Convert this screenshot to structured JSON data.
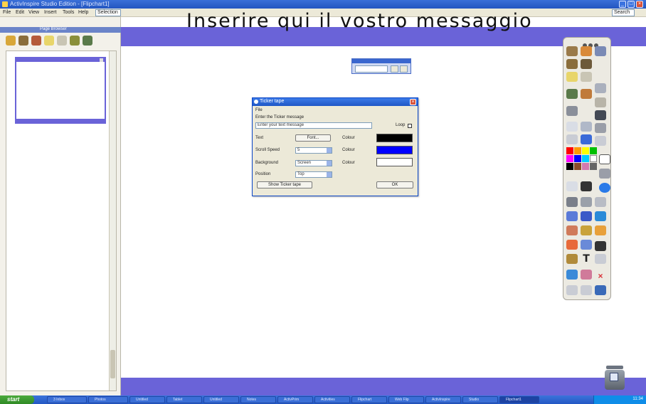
{
  "window": {
    "title": "ActivInspire Studio Edition - [Flipchart1]"
  },
  "menu": {
    "items": [
      "File",
      "Edit",
      "View",
      "Insert",
      "Tools",
      "Help"
    ],
    "zoom_value": "Selection"
  },
  "search_box": {
    "value": "Search"
  },
  "banner": {
    "text": "Inserire qui il vostro messaggio"
  },
  "left_panel": {
    "title": "Page Browser"
  },
  "dialog": {
    "title": "Ticker tape",
    "menu_file": "File",
    "section_label": "Enter the Ticker message",
    "message_value": "Enter your text message",
    "loop_label": "Loop",
    "text_label": "Text",
    "font_button": "Font...",
    "text_colour_label": "Colour",
    "scroll_speed_label": "Scroll Speed",
    "scroll_speed_value": "5",
    "scroll_colour_label": "Colour",
    "background_label": "Background",
    "background_value": "Screen",
    "background_colour_label": "Colour",
    "position_label": "Position",
    "position_value": "Top",
    "show_button": "Show Ticker tape",
    "ok_button": "OK",
    "colours": {
      "text": "#000000",
      "scroll": "#0000ff",
      "background": "#ffffff"
    }
  },
  "toolbox": {
    "title": ""
  },
  "taskbar": {
    "start_label": "start",
    "tasks": [
      "3 Inbox",
      "Photos",
      "Untitled",
      "Tablet",
      "Untitled",
      "Notes",
      "ActivPrim",
      "Activities",
      "Flipchart",
      "Web Flip",
      "ActivInspire",
      "Studio",
      "Flipchart1"
    ],
    "clock": "11:34"
  },
  "colors": {
    "accent": "#6a63d8",
    "xp_blue": "#2456c0"
  }
}
